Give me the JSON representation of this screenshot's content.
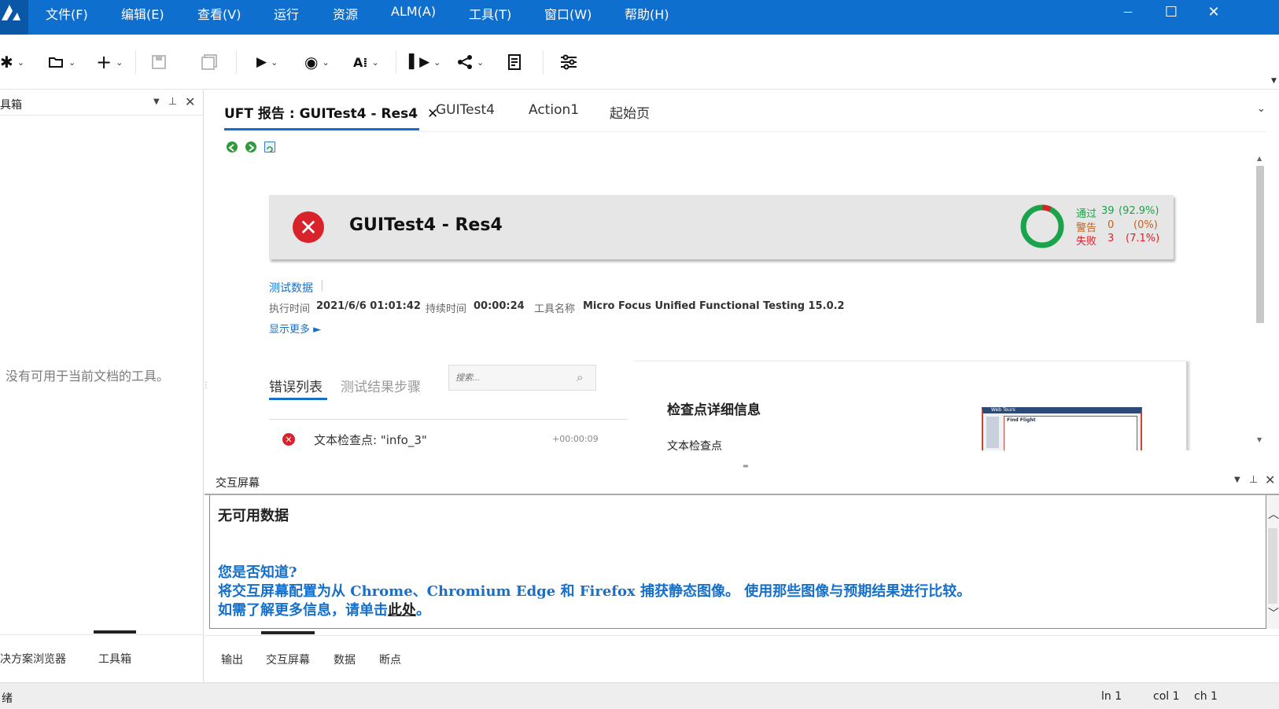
{
  "menubar": {
    "items": [
      "文件(F)",
      "编辑(E)",
      "查看(V)",
      "运行",
      "资源",
      "ALM(A)",
      "工具(T)",
      "窗口(W)",
      "帮助(H)"
    ],
    "minimize": "—",
    "maximize": "☐",
    "close": "✕"
  },
  "left_panel": {
    "title": "具箱",
    "empty_message": "没有可用于当前文档的工具。",
    "tabs": [
      "决方案浏览器",
      "工具箱"
    ]
  },
  "doc_tabs": [
    {
      "label": "UFT 报告 : GUITest4 - Res4",
      "active": true
    },
    {
      "label": "GUITest4",
      "active": false
    },
    {
      "label": "Action1",
      "active": false
    },
    {
      "label": "起始页",
      "active": false
    }
  ],
  "report": {
    "title": "GUITest4 - Res4",
    "stats": {
      "passed_label": "通过",
      "passed_count": "39",
      "passed_pct": "(92.9%)",
      "warn_label": "警告",
      "warn_count": "0",
      "warn_pct": "(0%)",
      "fail_label": "失败",
      "fail_count": "3",
      "fail_pct": "(7.1%)",
      "pass_fraction": 0.929,
      "fail_fraction": 0.071
    },
    "test_data_link": "测试数据",
    "exec_time_label": "执行时间",
    "exec_time": "2021/6/6 01:01:42",
    "duration_label": "持续时间",
    "duration": "00:00:24",
    "tool_label": "工具名称",
    "tool": "Micro Focus Unified Functional Testing 15.0.2",
    "show_more": "显示更多 ►",
    "tabs": [
      "错误列表",
      "测试结果步骤"
    ],
    "search_placeholder": "搜索...",
    "errors": [
      {
        "label": "文本检查点: \"info_3\"",
        "time": "+00:00:09"
      }
    ],
    "detail_title": "检查点详细信息",
    "detail_subtitle": "文本检查点",
    "thumb_title": "Find Flight",
    "thumb_header": "Web Tours"
  },
  "bottom_panel": {
    "title": "交互屏幕",
    "no_data": "无可用数据",
    "did_you_know": "您是否知道?",
    "tip_line": "将交互屏幕配置为从 Chrome、Chromium Edge 和 Firefox 捕获静态图像。 使用那些图像与预期结果进行比较。",
    "more_info_prefix": "如需了解更多信息，请单击",
    "more_info_link": "此处",
    "more_info_suffix": "。",
    "tabs": [
      "输出",
      "交互屏幕",
      "数据",
      "断点"
    ]
  },
  "statusbar": {
    "state": "绪",
    "ln": "ln 1",
    "col": "col 1",
    "ch": "ch 1"
  },
  "colors": {
    "accent": "#0f6fce",
    "pass": "#1aa34a",
    "fail": "#d8232a",
    "warn": "#c0641e",
    "link": "#1670c9"
  }
}
